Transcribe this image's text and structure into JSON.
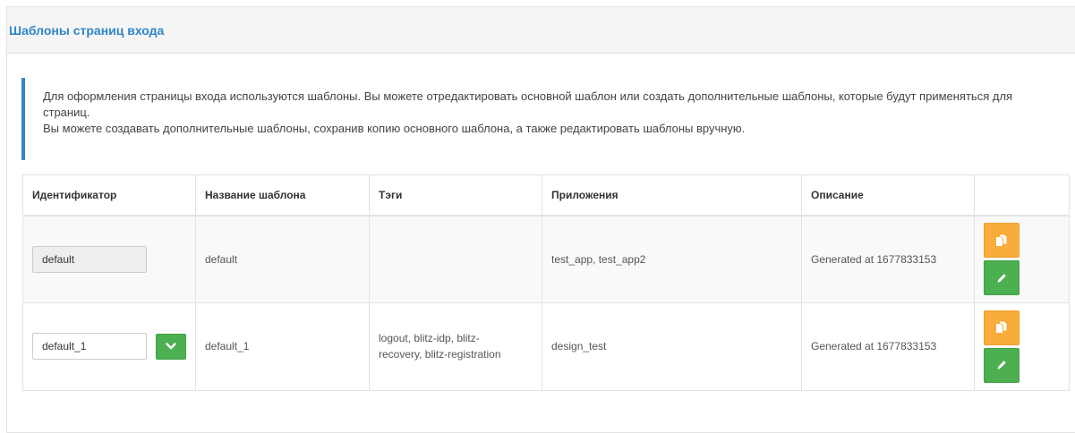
{
  "panel": {
    "title": "Шаблоны страниц входа"
  },
  "callout": {
    "line1": "Для оформления страницы входа используются шаблоны. Вы можете отредактировать основной шаблон или создать дополнительные шаблоны, которые будут применяться для страниц.",
    "line2": "Вы можете создавать дополнительные шаблоны, сохранив копию основного шаблона, а также редактировать шаблоны вручную."
  },
  "table": {
    "headers": {
      "id": "Идентификатор",
      "name": "Название шаблона",
      "tags": "Тэги",
      "apps": "Приложения",
      "desc": "Описание"
    },
    "rows": [
      {
        "id_value": "default",
        "name": "default",
        "tags": "",
        "apps": "test_app, test_app2",
        "desc": "Generated at 1677833153"
      },
      {
        "id_value": "default_1",
        "name": "default_1",
        "tags": "logout, blitz-idp, blitz-recovery, blitz-registration",
        "apps": "design_test",
        "desc": "Generated at 1677833153"
      }
    ]
  },
  "icons": {
    "copy": "copy-icon",
    "edit": "pencil-icon",
    "confirm": "chevron-down-icon"
  },
  "colors": {
    "accent": "#2f86c8",
    "copy_button": "#f8ac3a",
    "edit_button": "#4cb050"
  }
}
